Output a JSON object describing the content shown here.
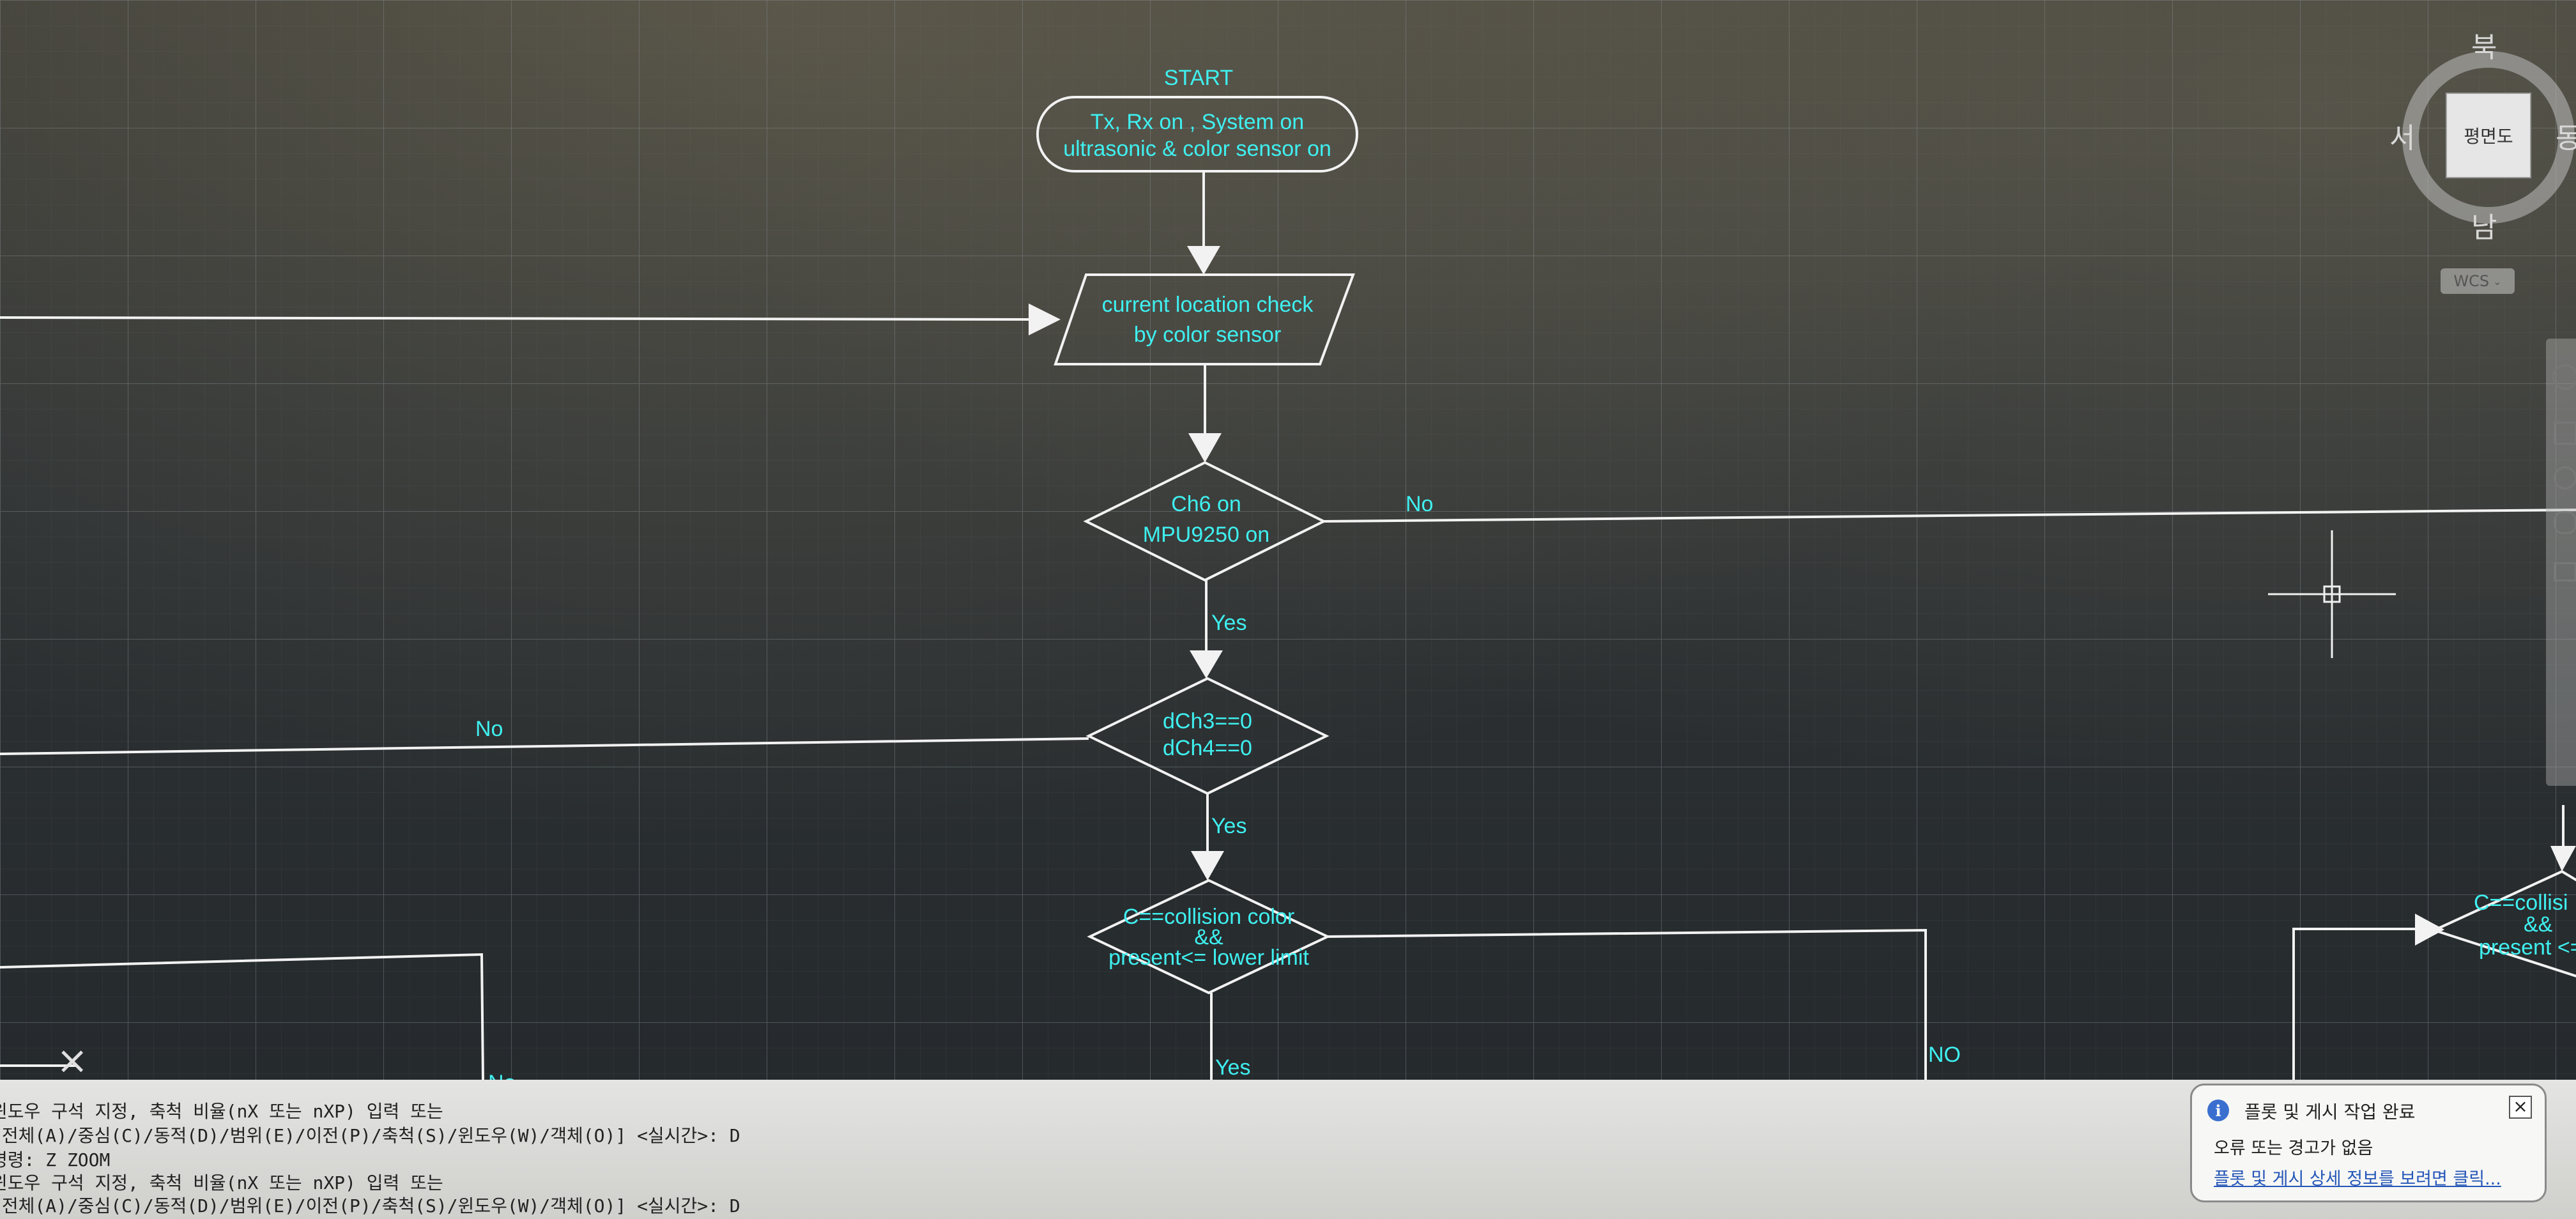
{
  "flowchart": {
    "start": "START",
    "init_line1": "Tx, Rx on , System on",
    "init_line2": "ultrasonic & color sensor on",
    "location_line1": "current location check",
    "location_line2": "by color sensor",
    "decision1_line1": "Ch6 on",
    "decision1_line2": "MPU9250 on",
    "decision2_line1": "dCh3==0",
    "decision2_line2": "dCh4==0",
    "decision3_line1": "C==collision color",
    "decision3_line2": "&&",
    "decision3_line3": "present<= lower limit",
    "right_decision_line1": "C==collisi",
    "right_decision_line2": "&&",
    "right_decision_line3": "present <=",
    "yes1": "Yes",
    "yes2": "Yes",
    "yes3": "Yes",
    "no1": "No",
    "no2": "No",
    "no3": "NO",
    "no_left_bottom": "No"
  },
  "viewcube": {
    "north": "북",
    "south": "남",
    "west": "서",
    "east": "동",
    "face": "평면도",
    "wcs": "WCS"
  },
  "command_line": {
    "rows": [
      "윈도우 구석 지정, 축척 비율(nX 또는 nXP) 입력 또는",
      "[전체(A)/중심(C)/동적(D)/범위(E)/이전(P)/축척(S)/윈도우(W)/객체(O)] <실시간>: D",
      "명령: Z ZOOM",
      "윈도우 구석 지정, 축척 비율(nX 또는 nXP) 입력 또는",
      "[전체(A)/중심(C)/동적(D)/범위(E)/이전(P)/축척(S)/윈도우(W)/객체(O)] <실시간>: D"
    ]
  },
  "notification": {
    "title": "플롯 및 게시 작업 완료",
    "message": "오류 또는 경고가 없음",
    "link": "플롯 및 게시 상세 정보를 보려면 클릭..."
  },
  "colors": {
    "text_cyan": "#3ff0f0",
    "line_white": "#f2f2f2",
    "canvas_bg": "#2b2d2f"
  }
}
